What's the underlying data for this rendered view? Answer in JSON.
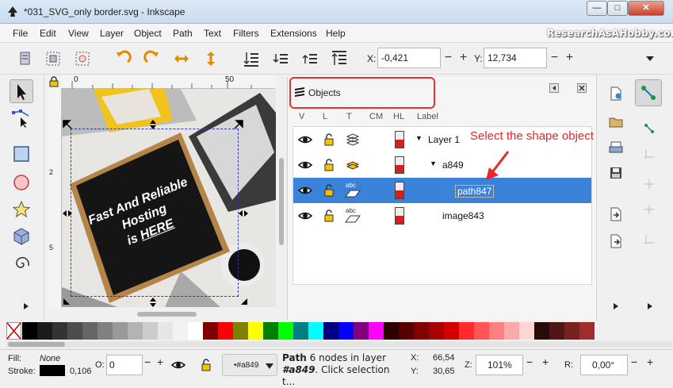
{
  "window": {
    "title": "*031_SVG_only border.svg - Inkscape",
    "controls": [
      "—",
      "□",
      "✕"
    ]
  },
  "watermark": "ResearchAsAHobby.com",
  "menu": [
    "File",
    "Edit",
    "View",
    "Layer",
    "Object",
    "Path",
    "Text",
    "Filters",
    "Extensions",
    "Help"
  ],
  "toolbar": {
    "x_label": "X:",
    "x_value": "-0,421",
    "y_label": "Y:",
    "y_value": "12,734",
    "minus": "−",
    "plus": "+"
  },
  "ruler": {
    "top_ticks": [
      "0",
      "50"
    ],
    "left_ticks": [
      "2",
      "5"
    ]
  },
  "canvas": {
    "board_lines": [
      "Fast And Reliable",
      "Hosting",
      "is"
    ],
    "board_emph": "HERE"
  },
  "objects_panel": {
    "title": "Objects",
    "columns": [
      "V",
      "L",
      "T",
      "CM",
      "HL",
      "Label"
    ],
    "annotation": "Select the shape object",
    "rows": [
      {
        "label": "Layer 1",
        "expander": "▼"
      },
      {
        "label": "a849",
        "expander": "▼"
      },
      {
        "label": "path847",
        "expander": ""
      },
      {
        "label": "image843",
        "expander": ""
      }
    ],
    "abc": "abc"
  },
  "statusbar": {
    "fill_label": "Fill:",
    "fill_value": "None",
    "stroke_label": "Stroke:",
    "stroke_width": "0,106",
    "opacity_label": "O:",
    "opacity_value": "0",
    "layer_value": "•#a849",
    "status_text_bold": "Path",
    "status_text": " 6 nodes in layer",
    "status_text2_bold": "#a849",
    "status_text2": ". Click selection t...",
    "cursor_x_label": "X:",
    "cursor_x": "66,54",
    "cursor_y_label": "Y:",
    "cursor_y": "30,65",
    "zoom_label": "Z:",
    "zoom_value": "101%",
    "rotate_label": "R:",
    "rotate_value": "0,00°"
  },
  "palette": [
    "#000000",
    "#1a1a1a",
    "#333333",
    "#4d4d4d",
    "#666666",
    "#808080",
    "#999999",
    "#b3b3b3",
    "#cccccc",
    "#e6e6e6",
    "#f2f2f2",
    "#ffffff",
    "#800000",
    "#ff0000",
    "#808000",
    "#ffff00",
    "#008000",
    "#00ff00",
    "#008080",
    "#00ffff",
    "#000080",
    "#0000ff",
    "#800080",
    "#ff00ff",
    "#2b0000",
    "#550000",
    "#800000",
    "#aa0000",
    "#d40000",
    "#ff2a2a",
    "#ff5555",
    "#ff8080",
    "#ffaaaa",
    "#ffd5d5",
    "#280b0b",
    "#501616",
    "#782121",
    "#a02c2c"
  ],
  "colors": {
    "accent_red": "#e63232",
    "selection_blue": "#3b83d8"
  }
}
